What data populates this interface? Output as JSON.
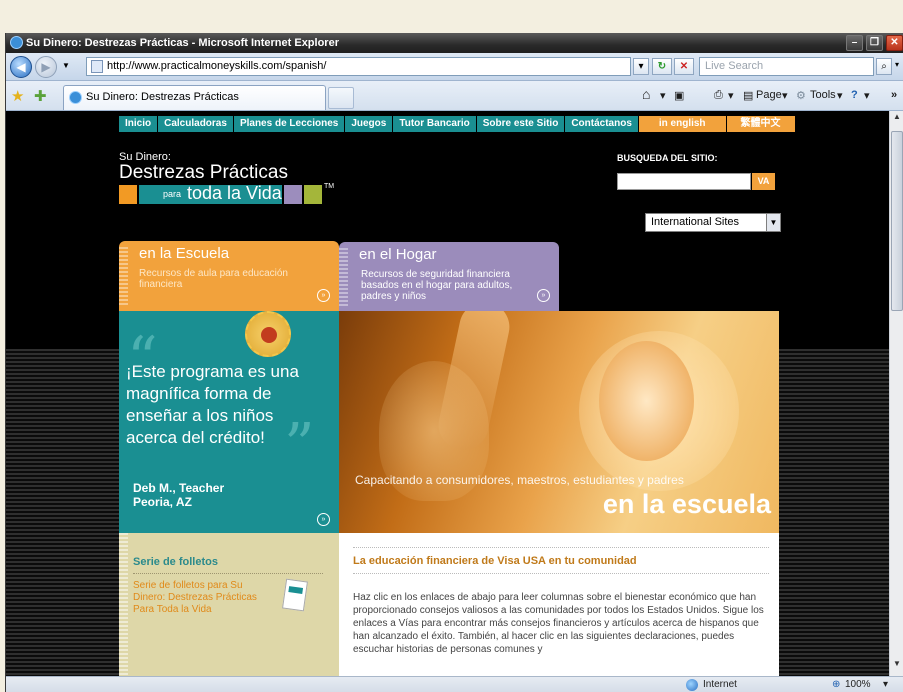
{
  "window": {
    "title": "Su Dinero: Destrezas Prácticas - Microsoft Internet Explorer"
  },
  "addressbar": {
    "url": "http://www.practicalmoneyskills.com/spanish/",
    "search_placeholder": "Live Search"
  },
  "tabs": [
    {
      "label": "Su Dinero: Destrezas Prácticas"
    }
  ],
  "commandbar": {
    "page_label": "Page",
    "tools_label": "Tools"
  },
  "site": {
    "nav": [
      "Inicio",
      "Calculadoras",
      "Planes de Lecciones",
      "Juegos",
      "Tutor Bancario",
      "Sobre este Sitio",
      "Contáctanos",
      "in english",
      "繁體中文"
    ],
    "logo": {
      "line1": "Su Dinero:",
      "line2": "Destrezas Prácticas",
      "para": "para",
      "toda": "toda la Vida",
      "tm": "TM"
    },
    "search": {
      "label": "BUSQUEDA DEL SITIO:",
      "button": "VA"
    },
    "intl_select": "International Sites",
    "escuela_tab": {
      "title": "en la Escuela",
      "desc": "Recursos de aula para educación financiera"
    },
    "hogar_tab": {
      "title": "en el Hogar",
      "desc": "Recursos de seguridad financiera basados en el hogar para adultos, padres y niños"
    },
    "quote": {
      "text": "¡Este programa es una magnífica forma de enseñar a los niños acerca del crédito!",
      "author": "Deb M., Teacher",
      "location": "Peoria, AZ"
    },
    "photo": {
      "caption": "Capacitando a consumidores, maestros, estudiantes y padres",
      "big": "en la escuela"
    },
    "folletos": {
      "title": "Serie de folletos",
      "desc": "Serie de folletos para Su Dinero: Destrezas Prácticas Para Toda la Vida"
    },
    "main": {
      "heading": "La educación financiera de Visa USA en tu comunidad",
      "body": "Haz clic en los enlaces de abajo para leer columnas sobre el bienestar económico que han proporcionado consejos valiosos a las comunidades por todos los Estados Unidos. Sigue los enlaces a Vías para encontrar más consejos financieros y artículos acerca de hispanos que han alcanzado el éxito. También, al hacer clic en las siguientes declaraciones, puedes escuchar historias de personas comunes y"
    }
  },
  "statusbar": {
    "zone": "Internet",
    "zoom": "100%"
  },
  "colors": {
    "teal": "#1a8f92",
    "orange": "#f2a23c",
    "purple": "#9b8cbb",
    "green": "#a4b63a"
  }
}
